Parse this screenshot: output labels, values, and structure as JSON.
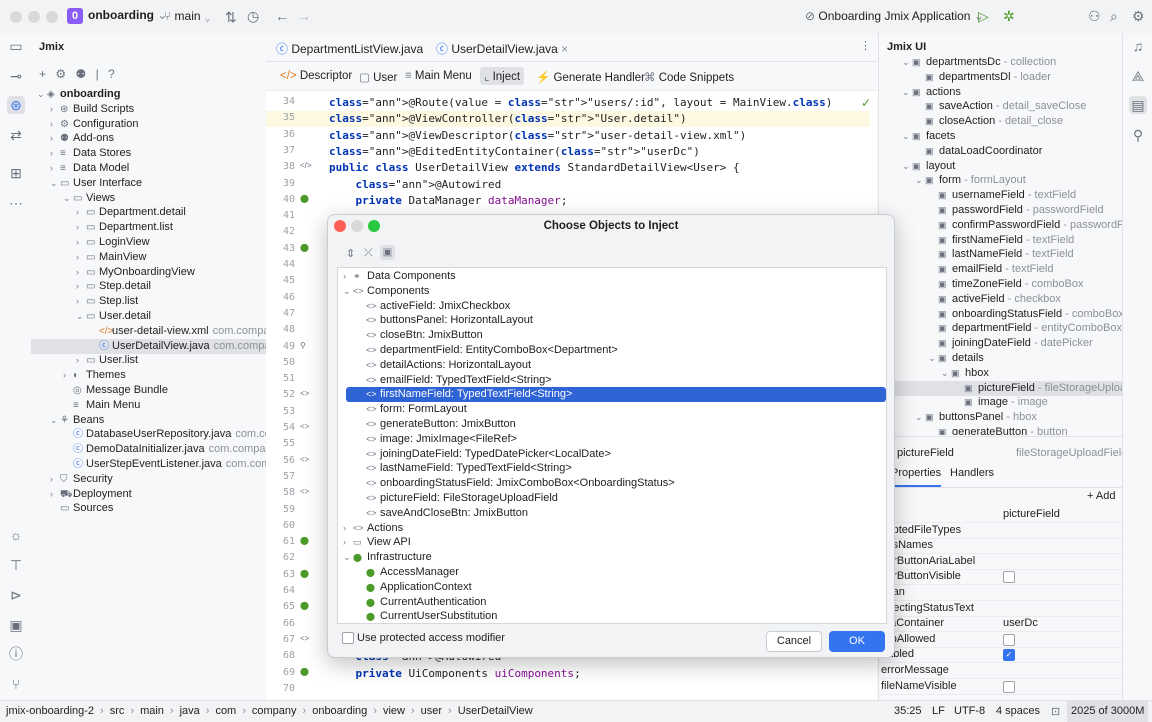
{
  "titlebar": {
    "project_badge": "0",
    "project_name": "onboarding",
    "branch": "main",
    "run_config": "Onboarding Jmix Application"
  },
  "editor_tabs": [
    {
      "label": "DepartmentListView.java"
    },
    {
      "label": "UserDetailView.java"
    }
  ],
  "project_panel": {
    "title": "Jmix",
    "help_label": "?",
    "tree": [
      {
        "label": "onboarding",
        "suffix": ""
      },
      {
        "label": "Build Scripts",
        "suffix": ""
      },
      {
        "label": "Configuration",
        "suffix": ""
      },
      {
        "label": "Add-ons",
        "suffix": ""
      },
      {
        "label": "Data Stores",
        "suffix": ""
      },
      {
        "label": "Data Model",
        "suffix": ""
      },
      {
        "label": "User Interface",
        "suffix": ""
      },
      {
        "label": "Views",
        "suffix": ""
      },
      {
        "label": "Department.detail",
        "suffix": ""
      },
      {
        "label": "Department.list",
        "suffix": ""
      },
      {
        "label": "LoginView",
        "suffix": ""
      },
      {
        "label": "MainView",
        "suffix": ""
      },
      {
        "label": "MyOnboardingView",
        "suffix": ""
      },
      {
        "label": "Step.detail",
        "suffix": ""
      },
      {
        "label": "Step.list",
        "suffix": ""
      },
      {
        "label": "User.detail",
        "suffix": ""
      },
      {
        "label": "user-detail-view.xml",
        "suffix": "com.compa"
      },
      {
        "label": "UserDetailView.java",
        "suffix": "com.compa"
      },
      {
        "label": "User.list",
        "suffix": ""
      },
      {
        "label": "Themes",
        "suffix": ""
      },
      {
        "label": "Message Bundle",
        "suffix": ""
      },
      {
        "label": "Main Menu",
        "suffix": ""
      },
      {
        "label": "Beans",
        "suffix": ""
      },
      {
        "label": "DatabaseUserRepository.java",
        "suffix": "com.con"
      },
      {
        "label": "DemoDataInitializer.java",
        "suffix": "com.company"
      },
      {
        "label": "UserStepEventListener.java",
        "suffix": "com.comp"
      },
      {
        "label": "Security",
        "suffix": ""
      },
      {
        "label": "Deployment",
        "suffix": ""
      },
      {
        "label": "Sources",
        "suffix": ""
      }
    ]
  },
  "editor_toolbar": {
    "descriptor": "Descriptor",
    "user": "User",
    "main_menu": "Main Menu",
    "inject": "Inject",
    "generate_handler": "Generate Handler",
    "code_snippets": "Code Snippets"
  },
  "code_lines": [
    {
      "num": "34",
      "text": "@Route(value = \"users/:id\", layout = MainView.class)"
    },
    {
      "num": "35",
      "text": "@ViewController(\"User.detail\")"
    },
    {
      "num": "36",
      "text": "@ViewDescriptor(\"user-detail-view.xml\")"
    },
    {
      "num": "37",
      "text": "@EditedEntityContainer(\"userDc\")"
    },
    {
      "num": "38",
      "text": "public class UserDetailView extends StandardDetailView<User> {"
    },
    {
      "num": "39",
      "text": "    @Autowired"
    },
    {
      "num": "40",
      "text": "    private DataManager dataManager;"
    },
    {
      "num": "41",
      "text": ""
    },
    {
      "num": "42",
      "text": ""
    },
    {
      "num": "43",
      "text": ""
    },
    {
      "num": "44",
      "text": ""
    },
    {
      "num": "45",
      "text": ""
    },
    {
      "num": "46",
      "text": ""
    },
    {
      "num": "47",
      "text": ""
    },
    {
      "num": "48",
      "text": ""
    },
    {
      "num": "49",
      "text": ""
    },
    {
      "num": "50",
      "text": ""
    },
    {
      "num": "51",
      "text": ""
    },
    {
      "num": "52",
      "text": ""
    },
    {
      "num": "53",
      "text": ""
    },
    {
      "num": "54",
      "text": ""
    },
    {
      "num": "55",
      "text": ""
    },
    {
      "num": "56",
      "text": ""
    },
    {
      "num": "57",
      "text": ""
    },
    {
      "num": "58",
      "text": ""
    },
    {
      "num": "59",
      "text": ""
    },
    {
      "num": "60",
      "text": ""
    },
    {
      "num": "61",
      "text": ""
    },
    {
      "num": "62",
      "text": ""
    },
    {
      "num": "63",
      "text": ""
    },
    {
      "num": "64",
      "text": ""
    },
    {
      "num": "65",
      "text": ""
    },
    {
      "num": "66",
      "text": ""
    },
    {
      "num": "67",
      "text": ""
    },
    {
      "num": "68",
      "text": "    @Autowired"
    },
    {
      "num": "69",
      "text": "    private UiComponents uiComponents;"
    },
    {
      "num": "70",
      "text": ""
    }
  ],
  "dialog": {
    "title": "Choose Objects to Inject",
    "items": [
      {
        "label": "Data Components",
        "level": 0,
        "arrow": "›"
      },
      {
        "label": "Components",
        "level": 0,
        "arrow": "⌄"
      },
      {
        "label": "activeField: JmixCheckbox",
        "level": 1,
        "arrow": ""
      },
      {
        "label": "buttonsPanel: HorizontalLayout",
        "level": 1,
        "arrow": ""
      },
      {
        "label": "closeBtn: JmixButton",
        "level": 1,
        "arrow": ""
      },
      {
        "label": "departmentField: EntityComboBox<Department>",
        "level": 1,
        "arrow": ""
      },
      {
        "label": "detailActions: HorizontalLayout",
        "level": 1,
        "arrow": ""
      },
      {
        "label": "emailField: TypedTextField<String>",
        "level": 1,
        "arrow": ""
      },
      {
        "label": "firstNameField: TypedTextField<String>",
        "level": 1,
        "arrow": ""
      },
      {
        "label": "form: FormLayout",
        "level": 1,
        "arrow": ""
      },
      {
        "label": "generateButton: JmixButton",
        "level": 1,
        "arrow": ""
      },
      {
        "label": "image: JmixImage<FileRef>",
        "level": 1,
        "arrow": ""
      },
      {
        "label": "joiningDateField: TypedDatePicker<LocalDate>",
        "level": 1,
        "arrow": ""
      },
      {
        "label": "lastNameField: TypedTextField<String>",
        "level": 1,
        "arrow": ""
      },
      {
        "label": "onboardingStatusField: JmixComboBox<OnboardingStatus>",
        "level": 1,
        "arrow": ""
      },
      {
        "label": "pictureField: FileStorageUploadField",
        "level": 1,
        "arrow": ""
      },
      {
        "label": "saveAndCloseBtn: JmixButton",
        "level": 1,
        "arrow": ""
      },
      {
        "label": "Actions",
        "level": 0,
        "arrow": "›"
      },
      {
        "label": "View API",
        "level": 0,
        "arrow": "›"
      },
      {
        "label": "Infrastructure",
        "level": 0,
        "arrow": "⌄"
      },
      {
        "label": "AccessManager",
        "level": 1,
        "arrow": ""
      },
      {
        "label": "ApplicationContext",
        "level": 1,
        "arrow": ""
      },
      {
        "label": "CurrentAuthentication",
        "level": 1,
        "arrow": ""
      },
      {
        "label": "CurrentUserSubstitution",
        "level": 1,
        "arrow": ""
      }
    ],
    "selected_index": 8,
    "checkbox_label": "Use protected access modifier",
    "cancel": "Cancel",
    "ok": "OK"
  },
  "jmix_ui": {
    "title": "Jmix UI",
    "tree": [
      {
        "label": "departmentsDc",
        "suffix": " - collection",
        "indent": 1
      },
      {
        "label": "departmentsDl",
        "suffix": " - loader",
        "indent": 2
      },
      {
        "label": "actions",
        "suffix": "",
        "indent": 1
      },
      {
        "label": "saveAction",
        "suffix": " - detail_saveClose",
        "indent": 2
      },
      {
        "label": "closeAction",
        "suffix": " - detail_close",
        "indent": 2
      },
      {
        "label": "facets",
        "suffix": "",
        "indent": 1
      },
      {
        "label": "dataLoadCoordinator",
        "suffix": "",
        "indent": 2
      },
      {
        "label": "layout",
        "suffix": "",
        "indent": 1
      },
      {
        "label": "form",
        "suffix": " - formLayout",
        "indent": 2
      },
      {
        "label": "usernameField",
        "suffix": " - textField",
        "indent": 3
      },
      {
        "label": "passwordField",
        "suffix": " - passwordField",
        "indent": 3
      },
      {
        "label": "confirmPasswordField",
        "suffix": " - passwordFiel",
        "indent": 3
      },
      {
        "label": "firstNameField",
        "suffix": " - textField",
        "indent": 3
      },
      {
        "label": "lastNameField",
        "suffix": " - textField",
        "indent": 3
      },
      {
        "label": "emailField",
        "suffix": " - textField",
        "indent": 3
      },
      {
        "label": "timeZoneField",
        "suffix": " - comboBox",
        "indent": 3
      },
      {
        "label": "activeField",
        "suffix": " - checkbox",
        "indent": 3
      },
      {
        "label": "onboardingStatusField",
        "suffix": " - comboBox",
        "indent": 3
      },
      {
        "label": "departmentField",
        "suffix": " - entityComboBox",
        "indent": 3
      },
      {
        "label": "joiningDateField",
        "suffix": " - datePicker",
        "indent": 3
      },
      {
        "label": "details",
        "suffix": "",
        "indent": 3
      },
      {
        "label": "hbox",
        "suffix": "",
        "indent": 4
      },
      {
        "label": "pictureField",
        "suffix": " - fileStorageUpload",
        "indent": 5
      },
      {
        "label": "image",
        "suffix": " - image",
        "indent": 5
      },
      {
        "label": "buttonsPanel",
        "suffix": " - hbox",
        "indent": 2
      },
      {
        "label": "generateButton",
        "suffix": " - button",
        "indent": 3
      }
    ],
    "selected_component": "pictureField",
    "selected_type": "fileStorageUploadField",
    "tab_properties": "Properties",
    "tab_handlers": "Handlers",
    "add_label": "+ Add",
    "properties": [
      {
        "name": "",
        "value": "pictureField",
        "type": "text"
      },
      {
        "name": "ceptedFileTypes",
        "value": "",
        "type": "text"
      },
      {
        "name": "assNames",
        "value": "",
        "type": "text"
      },
      {
        "name": "earButtonAriaLabel",
        "value": "",
        "type": "text"
      },
      {
        "name": "earButtonVisible",
        "value": "",
        "type": "checkbox",
        "checked": false
      },
      {
        "name": "span",
        "value": "",
        "type": "text"
      },
      {
        "name": "nnectingStatusText",
        "value": "",
        "type": "text"
      },
      {
        "name": "ataContainer",
        "value": "userDc",
        "type": "text"
      },
      {
        "name": "ropAllowed",
        "value": "",
        "type": "checkbox",
        "checked": false
      },
      {
        "name": "nabled",
        "value": "",
        "type": "checkbox",
        "checked": true
      },
      {
        "name": "errorMessage",
        "value": "",
        "type": "text"
      },
      {
        "name": "fileNameVisible",
        "value": "",
        "type": "checkbox",
        "checked": false
      }
    ]
  },
  "statusbar": {
    "breadcrumbs": [
      "jmix-onboarding-2",
      "src",
      "main",
      "java",
      "com",
      "company",
      "onboarding",
      "view",
      "user",
      "UserDetailView"
    ],
    "position": "35:25",
    "line_sep": "LF",
    "encoding": "UTF-8",
    "indent": "4 spaces",
    "memory": "2025 of 3000M"
  }
}
